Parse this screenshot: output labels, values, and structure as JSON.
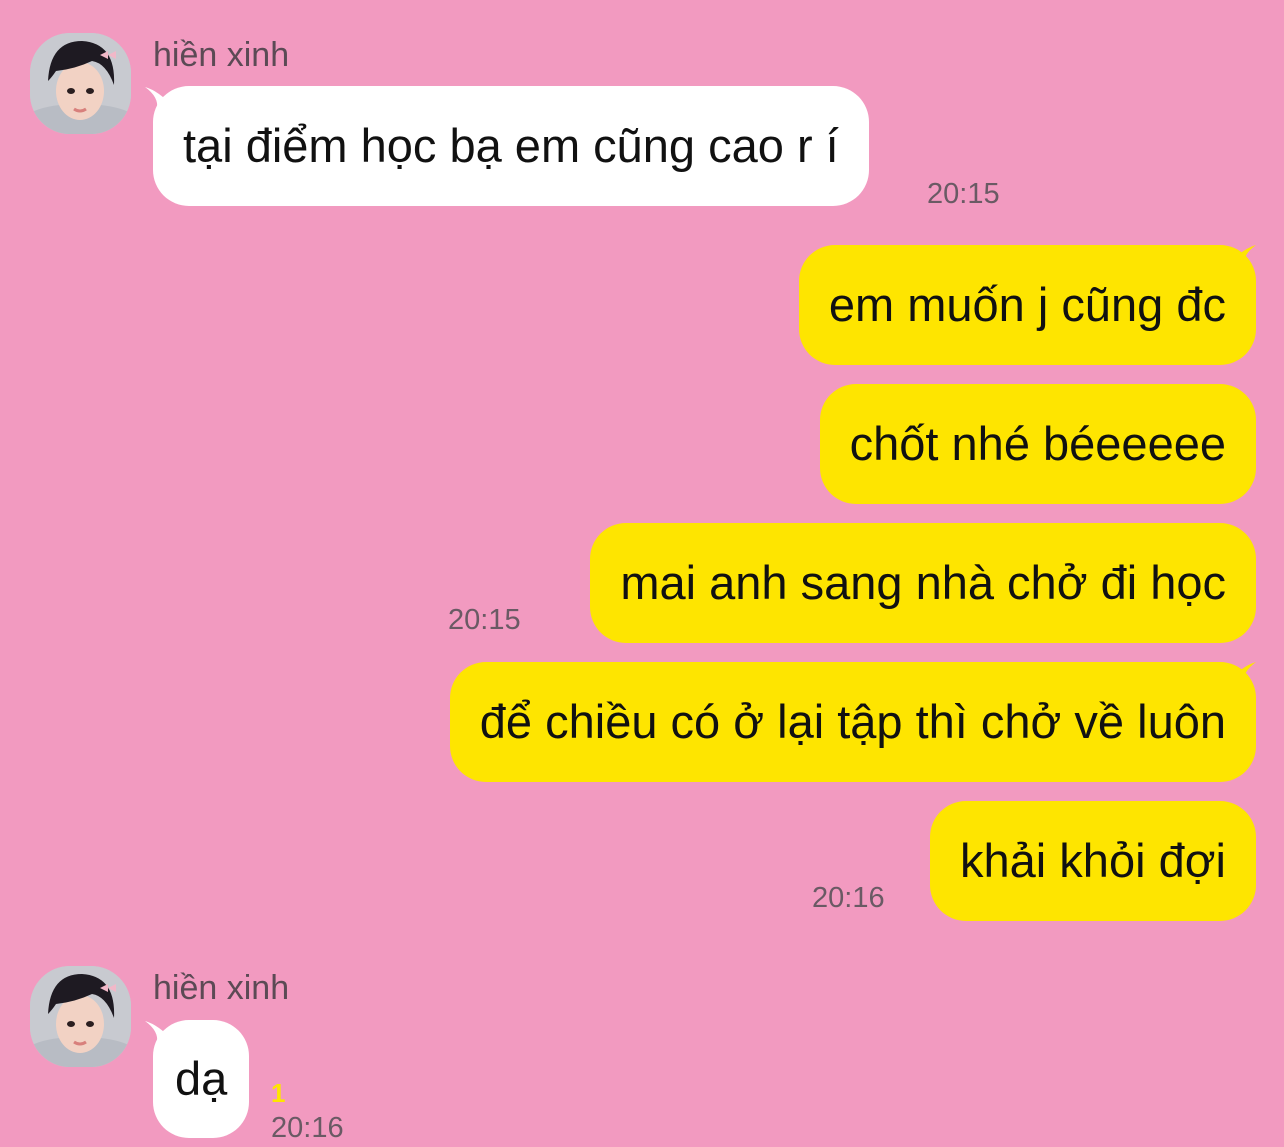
{
  "colors": {
    "background": "#f29ac0",
    "incoming_bubble": "#ffffff",
    "outgoing_bubble": "#fee500",
    "timestamp": "#6a5a64",
    "unread_badge": "#fee500"
  },
  "messages": [
    {
      "direction": "incoming",
      "sender": "hiền xinh",
      "text": "tại điểm học bạ em cũng cao r í",
      "time": "20:15"
    },
    {
      "direction": "outgoing",
      "texts": [
        "em muốn j cũng đc",
        "chốt nhé béeeeee",
        "mai anh sang nhà chở đi học"
      ],
      "time": "20:15"
    },
    {
      "direction": "outgoing",
      "texts": [
        "để chiều có ở lại tập thì chở về luôn",
        "khải khỏi đợi"
      ],
      "time": "20:16"
    },
    {
      "direction": "incoming",
      "sender": "hiền xinh",
      "text": "dạ",
      "unread": "1",
      "time": "20:16"
    }
  ]
}
